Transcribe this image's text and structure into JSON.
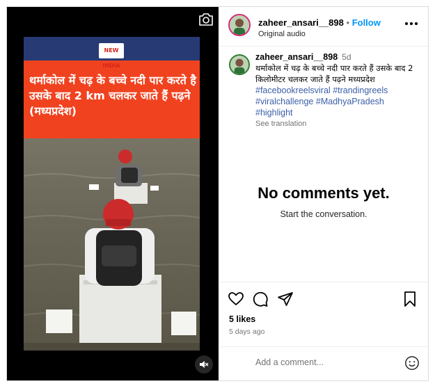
{
  "video": {
    "banner_logo": "NEW INDIA",
    "headline": "थर्माकोल में चढ़ के बच्चे नदी पार करते है उसके बाद 2 km चलकर जाते हैं पढ़ने (मध्यप्रदेश)",
    "camera_icon": "camera-icon",
    "mute_icon": "speaker-muted-icon"
  },
  "header": {
    "username": "zaheer_ansari__898",
    "separator": "•",
    "follow_label": "Follow",
    "subtitle": "Original audio",
    "more_icon": "more-horizontal-icon"
  },
  "caption": {
    "username": "zaheer_ansari__898",
    "time": "5d",
    "text": "थर्माकोल में चढ़ के बच्चे नदी पार करते हैं उसके बाद 2 किलोमीटर चलकर जाते हैं पढ़ने मध्यप्रदेश",
    "hashtags": [
      "#facebookreelsviral",
      "#trandingreels",
      "#viralchallenge",
      "#MadhyaPradesh",
      "#highlight"
    ],
    "see_translation": "See translation"
  },
  "comments": {
    "empty_title": "No comments yet.",
    "empty_subtitle": "Start the conversation."
  },
  "actions": {
    "like_icon": "heart-icon",
    "comment_icon": "comment-icon",
    "share_icon": "send-icon",
    "save_icon": "bookmark-icon",
    "likes": "5 likes",
    "time_ago": "5 days ago"
  },
  "composer": {
    "placeholder": "Add a comment...",
    "emoji_icon": "emoji-icon"
  },
  "colors": {
    "accent": "#0095f6",
    "banner_red": "#f0421f",
    "banner_navy": "#283a73",
    "hashtag": "#3b5ea8"
  }
}
